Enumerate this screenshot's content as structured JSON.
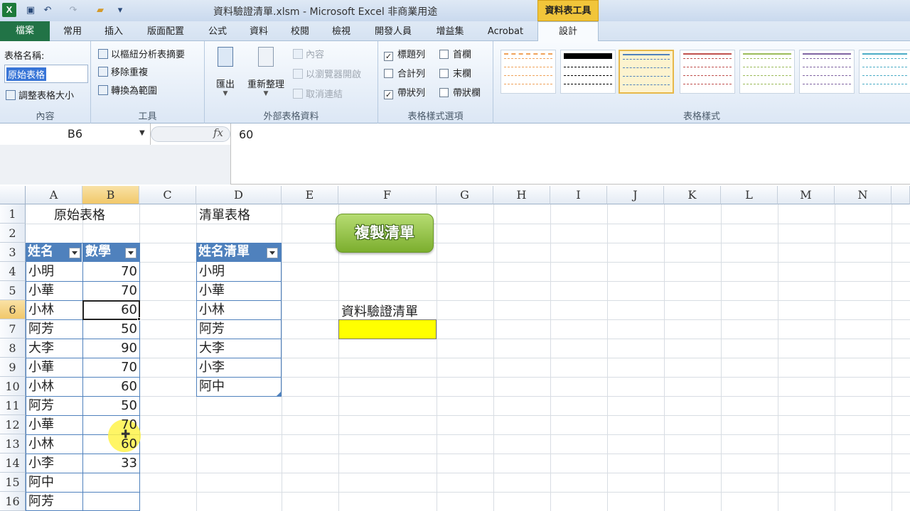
{
  "app": {
    "title": "資料驗證清單.xlsm - Microsoft Excel 非商業用途",
    "context_tab_group": "資料表工具",
    "excel_icon": "X"
  },
  "tabs": [
    "檔案",
    "常用",
    "插入",
    "版面配置",
    "公式",
    "資料",
    "校閱",
    "檢視",
    "開發人員",
    "增益集",
    "Acrobat",
    "設計"
  ],
  "ribbon": {
    "content_group": {
      "name_label": "表格名稱:",
      "name_value": "原始表格",
      "resize": "調整表格大小",
      "label": "內容"
    },
    "tools_group": {
      "items": [
        "以樞紐分析表摘要",
        "移除重複",
        "轉換為範圍"
      ],
      "label": "工具"
    },
    "external_group": {
      "export": "匯出",
      "refresh": "重新整理",
      "items": [
        "內容",
        "以瀏覽器開啟",
        "取消連結"
      ],
      "label": "外部表格資料"
    },
    "style_options": {
      "left": [
        {
          "label": "標題列",
          "checked": true
        },
        {
          "label": "合計列",
          "checked": false
        },
        {
          "label": "帶狀列",
          "checked": true
        }
      ],
      "right": [
        {
          "label": "首欄",
          "checked": false
        },
        {
          "label": "末欄",
          "checked": false
        },
        {
          "label": "帶狀欄",
          "checked": false
        }
      ],
      "label": "表格樣式選項"
    },
    "table_styles": {
      "label": "表格樣式"
    }
  },
  "formula_bar": {
    "name_box": "B6",
    "fx": "fx",
    "value": "60"
  },
  "columns": [
    "A",
    "B",
    "C",
    "D",
    "E",
    "F",
    "G",
    "H",
    "I",
    "J",
    "K",
    "L",
    "M",
    "N"
  ],
  "rows": [
    "1",
    "2",
    "3",
    "4",
    "5",
    "6",
    "7",
    "8",
    "9",
    "10",
    "11",
    "12",
    "13",
    "14",
    "15",
    "16"
  ],
  "sheet": {
    "title_a": "原始表格",
    "title_d": "清單表格",
    "table_a_headers": [
      "姓名",
      "數學"
    ],
    "table_a_names": [
      "小明",
      "小華",
      "小林",
      "阿芳",
      "大李",
      "小華",
      "小林",
      "阿芳",
      "小華",
      "小林",
      "小李",
      "阿中",
      "阿芳"
    ],
    "table_a_scores": [
      "70",
      "70",
      "60",
      "50",
      "90",
      "70",
      "60",
      "50",
      "70",
      "60",
      "33",
      "",
      ""
    ],
    "table_d_header": "姓名清單",
    "table_d_names": [
      "小明",
      "小華",
      "小林",
      "阿芳",
      "大李",
      "小李",
      "阿中"
    ],
    "button": "複製清單",
    "validation_label": "資料驗證清單",
    "validation_fill": "#ffff00"
  }
}
